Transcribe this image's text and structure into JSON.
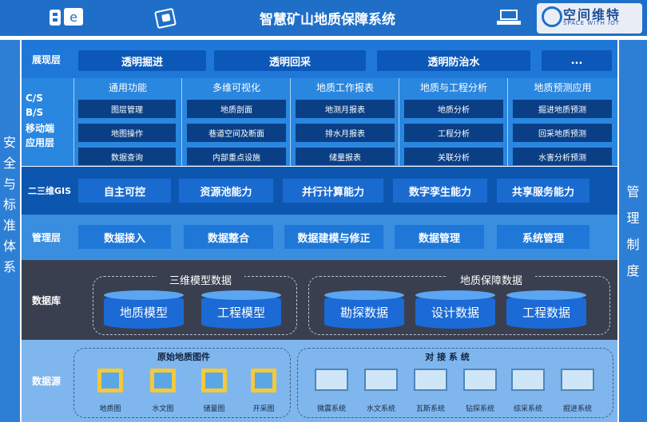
{
  "header": {
    "title": "智慧矿山地质保障系统",
    "left_icons": [
      "server-icon",
      "monitor-e-icon",
      "touch-device-icon"
    ],
    "right_icons": [
      "laptop-icon"
    ],
    "brand": {
      "name": "空间维特",
      "sub": "SPACE WITH IOT"
    }
  },
  "left_bar": {
    "chars": [
      "安",
      "全",
      "与",
      "标",
      "准",
      "体",
      "系"
    ]
  },
  "right_bar": {
    "chars": [
      "管",
      "理",
      "制",
      "度"
    ]
  },
  "presentation": {
    "label": "展现层",
    "items": [
      "透明掘进",
      "透明回采",
      "透明防治水",
      "..."
    ]
  },
  "application": {
    "label_lines": [
      "C/S",
      "B/S",
      "移动端",
      "应用层"
    ],
    "columns": [
      {
        "title": "通用功能",
        "items": [
          "图层管理",
          "地图操作",
          "数据查询"
        ]
      },
      {
        "title": "多维可视化",
        "items": [
          "地质剖面",
          "巷道空间及断面",
          "内部重点设施"
        ]
      },
      {
        "title": "地质工作报表",
        "items": [
          "地测月报表",
          "排水月报表",
          "储量报表"
        ]
      },
      {
        "title": "地质与工程分析",
        "items": [
          "地质分析",
          "工程分析",
          "关联分析"
        ]
      },
      {
        "title": "地质预测应用",
        "items": [
          "掘进地质预测",
          "回采地质预测",
          "水害分析预测"
        ]
      }
    ]
  },
  "gis": {
    "label": "二三维GIS",
    "items": [
      "自主可控",
      "资源池能力",
      "并行计算能力",
      "数字孪生能力",
      "共享服务能力"
    ]
  },
  "management": {
    "label": "管理层",
    "items": [
      "数据接入",
      "数据整合",
      "数据建模与修正",
      "数据管理",
      "系统管理"
    ]
  },
  "database": {
    "label": "数据库",
    "groups": [
      {
        "title": "三维模型数据",
        "items": [
          "地质模型",
          "工程模型"
        ]
      },
      {
        "title": "地质保障数据",
        "items": [
          "勘探数据",
          "设计数据",
          "工程数据"
        ]
      }
    ]
  },
  "datasource": {
    "label": "数据源",
    "groups": [
      {
        "title": "原始地质图件",
        "items": [
          "地质图",
          "水文图",
          "储量图",
          "开采图"
        ]
      },
      {
        "title": "对 接 系 统",
        "items": [
          "微震系统",
          "水文系统",
          "瓦斯系统",
          "钻探系统",
          "综采系统",
          "掘进系统"
        ]
      }
    ]
  },
  "colors": {
    "header": "#1f6fc9",
    "presentation_bg": "#1f78d8",
    "application_bg": "#2a87e0",
    "gis_bg": "#0c56b0",
    "management_bg": "#3a8ee0",
    "database_bg": "#3a3f4f",
    "datasource_bg": "#7fb6ee"
  }
}
